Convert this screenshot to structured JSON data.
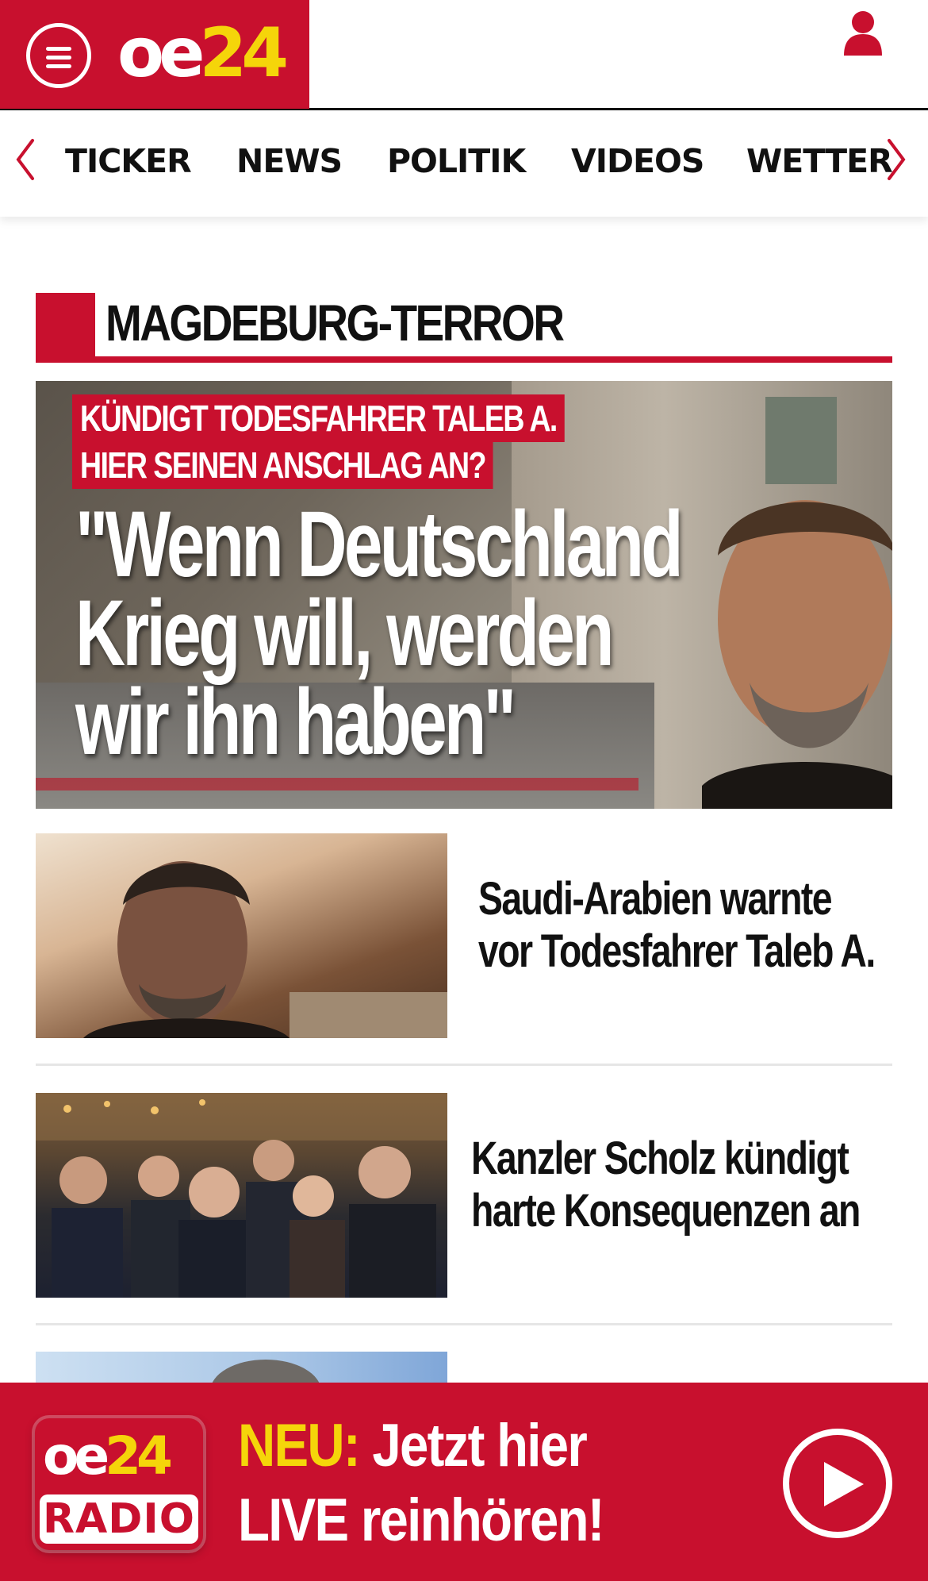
{
  "header": {
    "logo_oe": "oe",
    "logo_num": "24",
    "menu_icon": "hamburger-menu-icon",
    "user_icon": "user-icon"
  },
  "nav": {
    "items": [
      {
        "label": "TICKER"
      },
      {
        "label": "NEWS"
      },
      {
        "label": "POLITIK"
      },
      {
        "label": "VIDEOS"
      },
      {
        "label": "WETTER"
      }
    ],
    "left_arrow_icon": "chevron-left-icon",
    "right_arrow_icon": "chevron-right-icon"
  },
  "section": {
    "title": "MAGDEBURG-TERROR"
  },
  "hero": {
    "kicker_line1": "KÜNDIGT TODESFAHRER TALEB A.",
    "kicker_line2": "HIER SEINEN ANSCHLAG AN?",
    "headline": "\"Wenn Deutschland\nKrieg will, werden\nwir ihn haben\""
  },
  "articles": [
    {
      "title": "Saudi-Arabien warnte\nvor Todesfahrer Taleb A."
    },
    {
      "title": "Kanzler Scholz kündigt\nharte Konsequenzen an"
    }
  ],
  "radio": {
    "logo_oe": "oe",
    "logo_num": "24",
    "logo_label": "RADIO",
    "neu": "NEU:",
    "line1_rest": " Jetzt hier",
    "line2": "LIVE reinhören!",
    "play_icon": "play-icon"
  },
  "colors": {
    "brand_red": "#c8102e",
    "brand_yellow": "#f5d50a"
  }
}
